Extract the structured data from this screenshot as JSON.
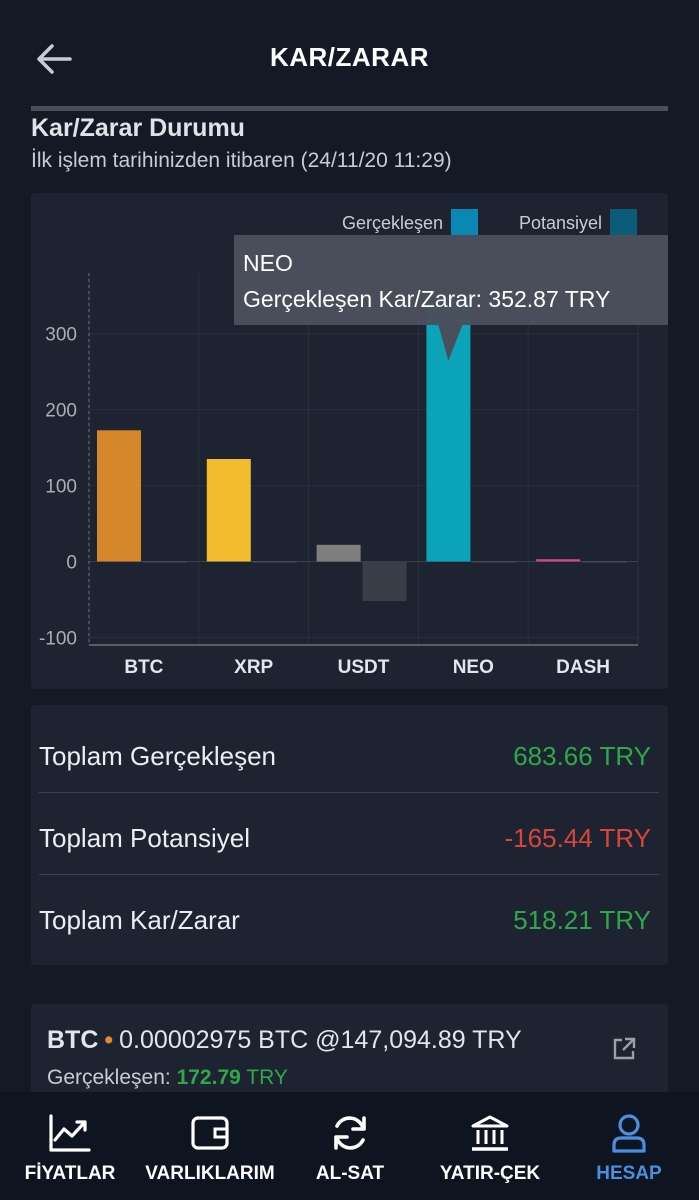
{
  "header": {
    "title": "KAR/ZARAR",
    "back_icon": "arrow-left-icon"
  },
  "section": {
    "title": "Kar/Zarar Durumu",
    "subtitle": "İlk işlem tarihinizden itibaren (24/11/20 11:29)"
  },
  "chart_data": {
    "type": "bar",
    "categories": [
      "BTC",
      "XRP",
      "USDT",
      "NEO",
      "DASH"
    ],
    "series": [
      {
        "name": "Gerçekleşen",
        "values": [
          172.79,
          135,
          22,
          352.87,
          3
        ]
      },
      {
        "name": "Potansiyel",
        "values": [
          0,
          0,
          -52,
          0,
          0
        ]
      }
    ],
    "category_colors": [
      "#d6872a",
      "#f3bc2f",
      "#7f7f7f",
      "#0aa3b8",
      "#d0458f"
    ],
    "potential_color": "#3a3e48",
    "legend_colors": [
      "#0b87b4",
      "#0c5b78"
    ],
    "legend_position": "top-right",
    "yticks": [
      300,
      200,
      100,
      0,
      -100
    ],
    "ylim": [
      -110,
      380
    ],
    "grid": true,
    "tooltip": {
      "title": "NEO",
      "text": "Gerçekleşen Kar/Zarar: 352.87 TRY"
    }
  },
  "summary": {
    "rows": [
      {
        "label": "Toplam Gerçekleşen",
        "value": "683.66 TRY",
        "status": "positive"
      },
      {
        "label": "Toplam Potansiyel",
        "value": "-165.44 TRY",
        "status": "negative"
      },
      {
        "label": "Toplam Kar/Zarar",
        "value": "518.21 TRY",
        "status": "positive"
      }
    ]
  },
  "btc_card": {
    "symbol": "BTC",
    "dot": "•",
    "amount": "0.00002975 BTC",
    "at": "@",
    "price": "147,094.89 TRY",
    "realized_label": "Gerçekleşen:",
    "realized_value": "172.79",
    "realized_currency": "TRY"
  },
  "nav": {
    "items": [
      {
        "label": "FİYATLAR",
        "icon": "chart-line-icon"
      },
      {
        "label": "VARLIKLARIM",
        "icon": "wallet-icon"
      },
      {
        "label": "AL-SAT",
        "icon": "refresh-icon"
      },
      {
        "label": "YATIR-ÇEK",
        "icon": "bank-icon"
      },
      {
        "label": "HESAP",
        "icon": "user-icon",
        "active": true
      }
    ]
  },
  "colors": {
    "background": "#131a26",
    "card": "#1d2330",
    "positive": "#2ea84a",
    "negative": "#d8463b",
    "active_nav": "#4b8fe0"
  }
}
